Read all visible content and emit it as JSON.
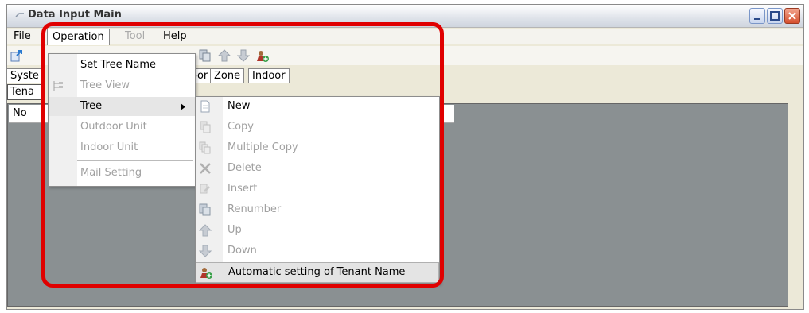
{
  "window": {
    "title": "Data Input Main"
  },
  "menubar": {
    "file": "File",
    "operation": "Operation",
    "tool": "Tool",
    "help": "Help"
  },
  "tabs": {
    "system_partial": "Syste",
    "outdoor_partial": "oor",
    "zone": "Zone",
    "indoor": "Indoor"
  },
  "subtab": {
    "tenant_partial": "Tena"
  },
  "grid": {
    "header_partial": "No"
  },
  "operation_menu": {
    "items": [
      {
        "label": "Set Tree Name"
      },
      {
        "label": "Tree View"
      },
      {
        "label": "Tree"
      },
      {
        "label": "Outdoor Unit"
      },
      {
        "label": "Indoor Unit"
      },
      {
        "label": "Mail Setting"
      }
    ]
  },
  "tree_submenu": {
    "items": [
      {
        "label": "New"
      },
      {
        "label": "Copy"
      },
      {
        "label": "Multiple Copy"
      },
      {
        "label": "Delete"
      },
      {
        "label": "Insert"
      },
      {
        "label": "Renumber"
      },
      {
        "label": "Up"
      },
      {
        "label": "Down"
      },
      {
        "label": "Automatic setting of Tenant Name"
      }
    ]
  },
  "colors": {
    "highlight": "#e00000",
    "grid_bg": "#8a9092"
  }
}
